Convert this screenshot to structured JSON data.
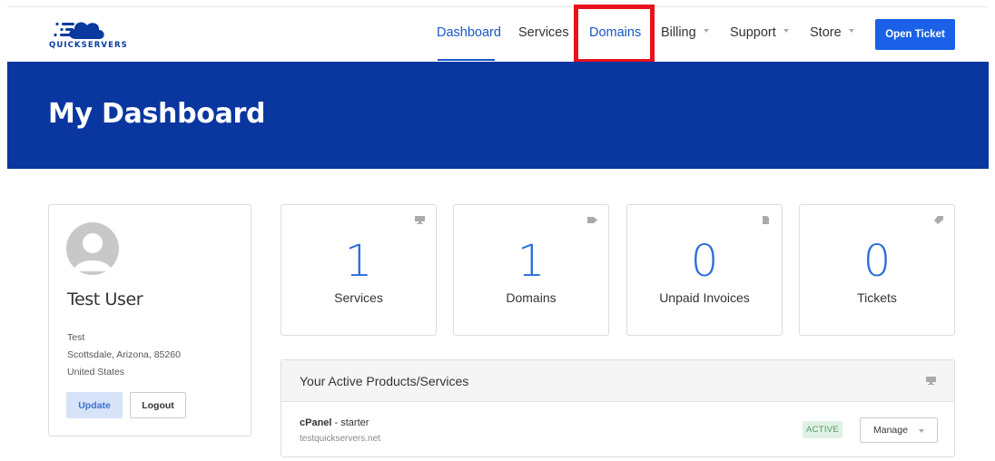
{
  "brand": {
    "logo_text": "QUICKSERVERS"
  },
  "nav": {
    "items": [
      {
        "label": "Dashboard",
        "active": true
      },
      {
        "label": "Services"
      },
      {
        "label": "Domains",
        "highlighted": true
      },
      {
        "label": "Billing",
        "has_caret": true
      },
      {
        "label": "Support",
        "has_caret": true
      },
      {
        "label": "Store",
        "has_caret": true
      }
    ],
    "open_ticket_label": "Open Ticket"
  },
  "hero": {
    "title": "My Dashboard"
  },
  "profile": {
    "name": "Test User",
    "company": "Test",
    "city_line": "Scottsdale, Arizona, 85260",
    "country": "United States",
    "update_label": "Update",
    "logout_label": "Logout"
  },
  "stats": [
    {
      "value": "1",
      "label": "Services",
      "icon": "server-icon"
    },
    {
      "value": "1",
      "label": "Domains",
      "icon": "tag-icon"
    },
    {
      "value": "0",
      "label": "Unpaid Invoices",
      "icon": "document-icon"
    },
    {
      "value": "0",
      "label": "Tickets",
      "icon": "ticket-icon"
    }
  ],
  "products_panel": {
    "title": "Your Active Products/Services",
    "items": [
      {
        "product": "cPanel",
        "plan": " - starter",
        "domain": "testquickservers.net",
        "status": "ACTIVE",
        "manage_label": "Manage"
      }
    ]
  },
  "colors": {
    "primary": "#1a61e8",
    "hero_bg": "#0a36a0",
    "highlight": "#e8121e",
    "status_active_bg": "#dff1e4",
    "status_active_text": "#4f9c63"
  }
}
